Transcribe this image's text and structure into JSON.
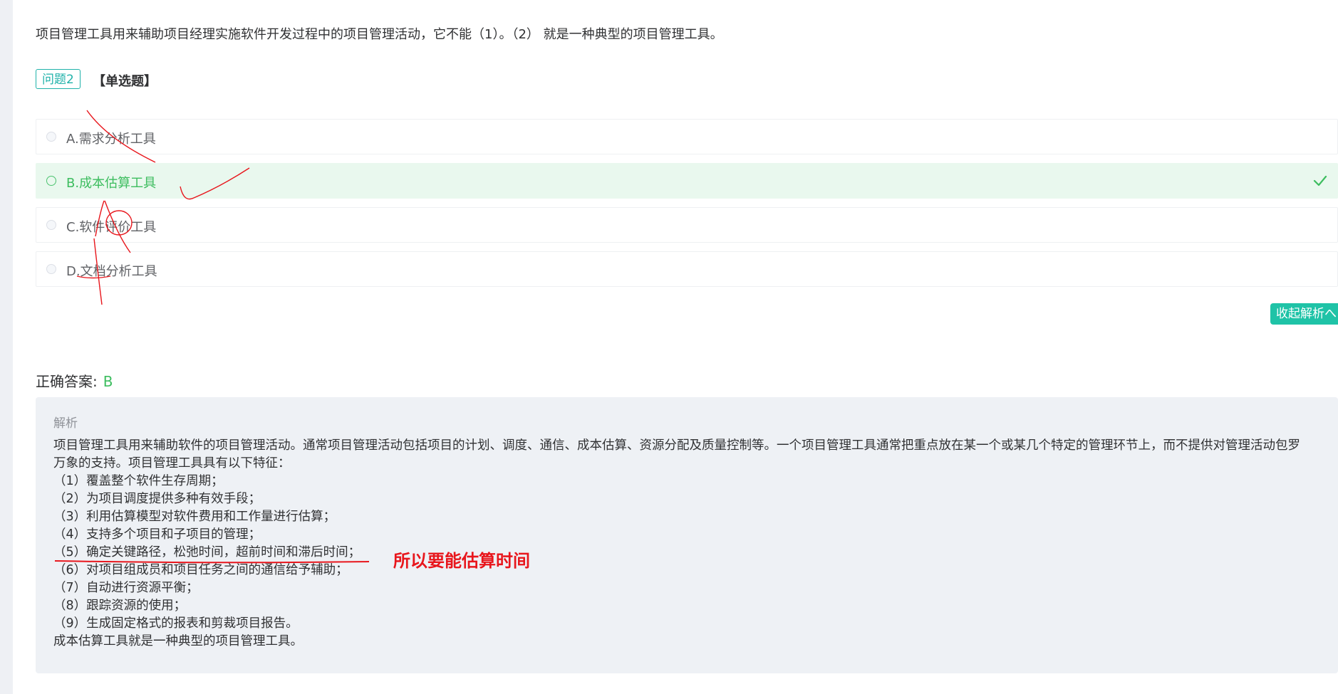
{
  "question": {
    "text": "项目管理工具用来辅助项目经理实施软件开发过程中的项目管理活动，它不能（1）。（2） 就是一种典型的项目管理工具。",
    "tag": "问题2",
    "type": "【单选题】"
  },
  "options": [
    {
      "label": "A.需求分析工具",
      "state": "unselected"
    },
    {
      "label": "B.成本估算工具",
      "state": "correct"
    },
    {
      "label": "C.软件评价工具",
      "state": "unselected"
    },
    {
      "label": "D.文档分析工具",
      "state": "unselected"
    }
  ],
  "collapse_button": {
    "label": "收起解析へ"
  },
  "answer": {
    "label": "正确答案:",
    "value": "B"
  },
  "analysis": {
    "title": "解析",
    "lines": [
      "项目管理工具用来辅助软件的项目管理活动。通常项目管理活动包括项目的计划、调度、通信、成本估算、资源分配及质量控制等。一个项目管理工具通常把重点放在某一个或某几个特定的管理环节上，而不提供对管理活动包罗",
      "万象的支持。项目管理工具具有以下特征：",
      "（1）覆盖整个软件生存周期；",
      "（2）为项目调度提供多种有效手段；",
      "（3）利用估算模型对软件费用和工作量进行估算；",
      "（4）支持多个项目和子项目的管理；",
      "（5）确定关键路径，松弛时间，超前时间和滞后时间；",
      "（6）对项目组成员和项目任务之间的通信给予辅助；",
      "（7）自动进行资源平衡；",
      "（8）跟踪资源的使用；",
      "（9）生成固定格式的报表和剪裁项目报告。",
      "成本估算工具就是一种典型的项目管理工具。"
    ]
  },
  "annotation": {
    "note": "所以要能估算时间"
  },
  "colors": {
    "accent": "#1fc3a7",
    "correct": "#3dbd5f",
    "correct_bg": "#e9f8ee",
    "annotation": "#e8161c",
    "analysis_bg": "#eef1f5"
  },
  "icons": {
    "check": "check-icon",
    "radio": "radio-icon"
  }
}
